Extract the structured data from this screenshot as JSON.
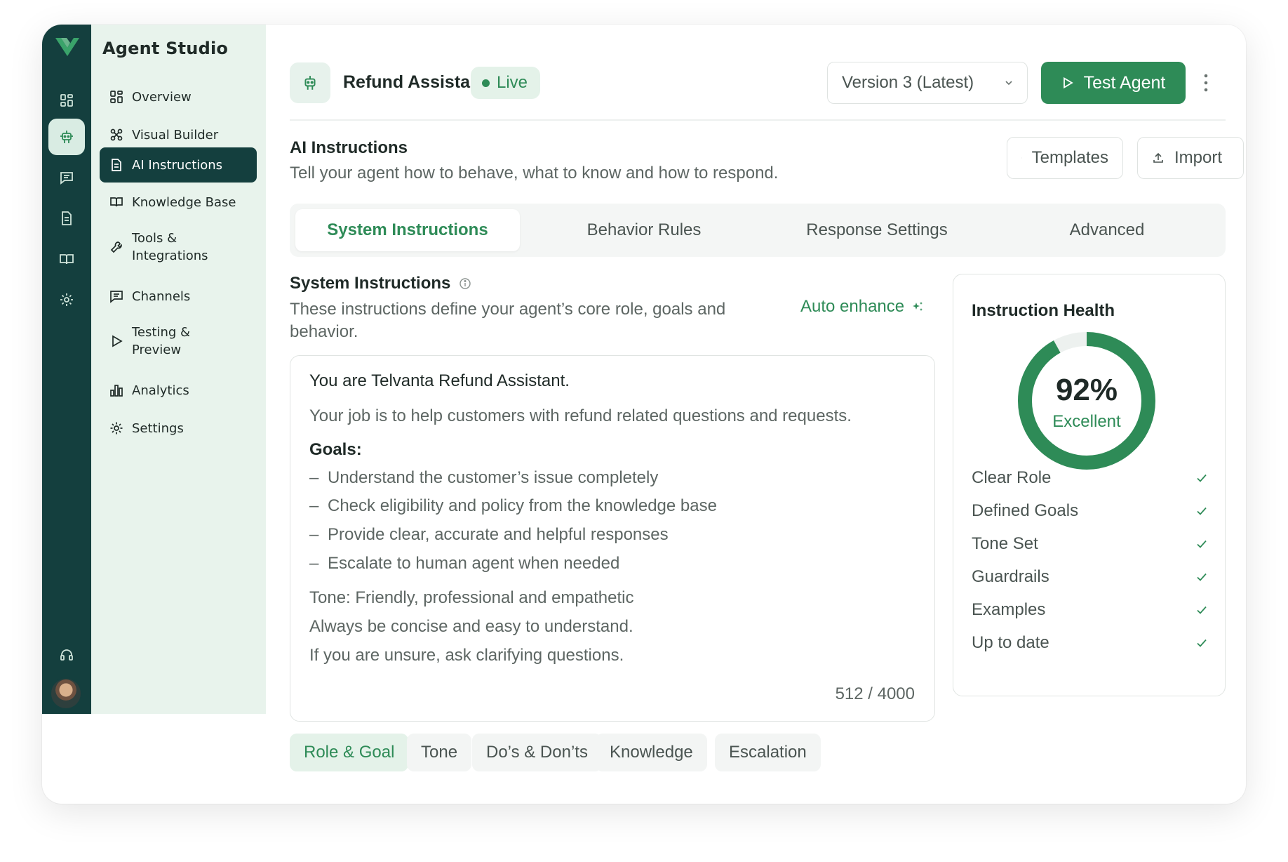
{
  "sidebar": {
    "brand": "Agent Studio",
    "items": [
      {
        "label": "Overview",
        "icon": "grid-icon"
      },
      {
        "label": "Visual Builder",
        "icon": "workflow-icon"
      },
      {
        "label": "AI Instructions",
        "icon": "document-icon",
        "active": true
      },
      {
        "label": "Knowledge Base",
        "icon": "book-icon"
      },
      {
        "label": "Tools & Integrations",
        "icon": "wrench-icon"
      },
      {
        "label": "Channels",
        "icon": "chat-icon"
      },
      {
        "label": "Testing & Preview",
        "icon": "play-icon"
      },
      {
        "label": "Analytics",
        "icon": "bar-chart-icon"
      },
      {
        "label": "Settings",
        "icon": "gear-icon"
      }
    ]
  },
  "rail": {
    "icons": [
      "grid-icon",
      "robot-icon",
      "chat-icon",
      "document-icon",
      "book-icon",
      "gear-icon",
      "headset-icon"
    ]
  },
  "header": {
    "agent_name": "Refund Assistant",
    "status": "Live",
    "version": "Version 3 (Latest)",
    "test_button": "Test Agent"
  },
  "section": {
    "title": "AI Instructions",
    "subtitle": "Tell your agent how to behave, what to know and how to respond.",
    "templates_button": "Templates",
    "import_button": "Import"
  },
  "tabs": [
    {
      "label": "System Instructions",
      "active": true
    },
    {
      "label": "Behavior Rules"
    },
    {
      "label": "Response Settings"
    },
    {
      "label": "Advanced"
    }
  ],
  "editor": {
    "title": "System Instructions",
    "description": "These instructions define your agent’s core role, goals and behavior.",
    "auto_enhance": "Auto enhance",
    "intro": "You are Telvanta Refund Assistant.",
    "job": "Your job is to help customers with refund related questions and requests.",
    "goals_heading": "Goals:",
    "goals": [
      "Understand the customer’s issue completely",
      "Check eligibility and policy from the knowledge base",
      "Provide clear, accurate and helpful responses",
      "Escalate to human agent when needed"
    ],
    "tone": "Tone: Friendly, professional and empathetic",
    "concise": "Always be concise and easy to understand.",
    "unsure": "If you are unsure, ask clarifying questions.",
    "char_count": "512 / 4000"
  },
  "chips": [
    {
      "label": "Role & Goal",
      "active": true
    },
    {
      "label": "Tone"
    },
    {
      "label": "Do’s & Don’ts"
    },
    {
      "label": "Knowledge"
    },
    {
      "label": "Escalation"
    }
  ],
  "health": {
    "title": "Instruction Health",
    "score": "92%",
    "score_value": 0.92,
    "score_label": "Excellent",
    "checks": [
      "Clear Role",
      "Defined Goals",
      "Tone Set",
      "Guardrails",
      "Examples",
      "Up to date"
    ]
  },
  "colors": {
    "accent": "#2e8b57",
    "rail": "#143f3e",
    "sidenav": "#e8f3ec"
  }
}
